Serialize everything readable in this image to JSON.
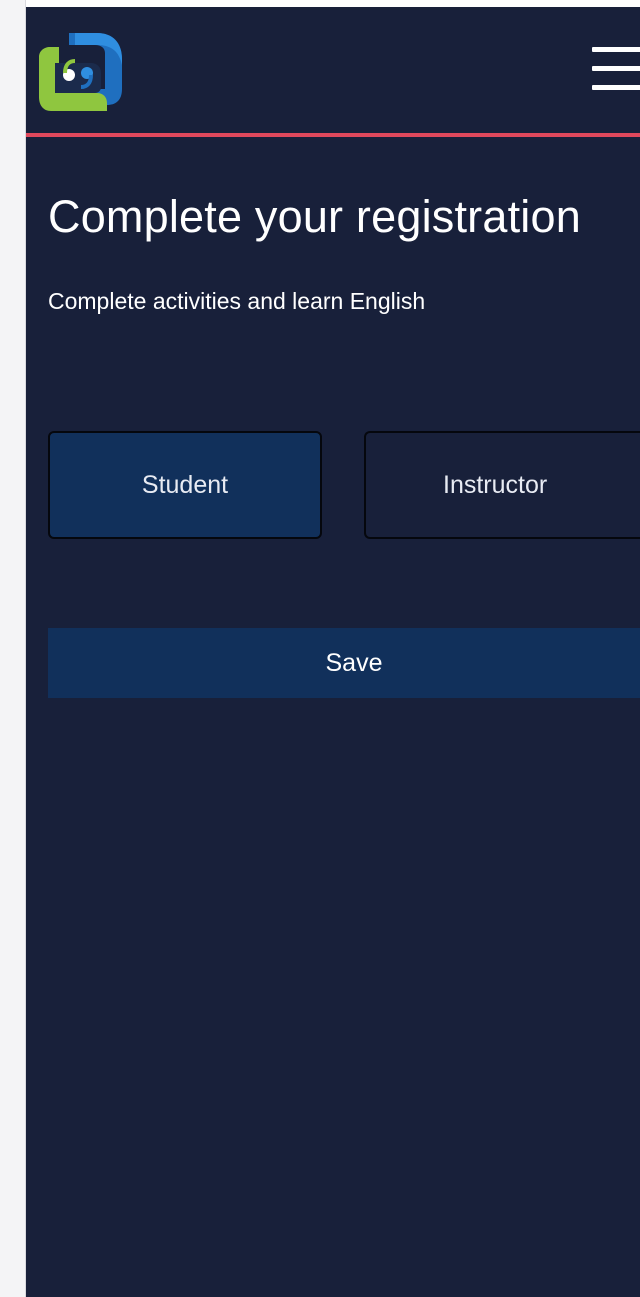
{
  "header": {
    "logo_icon": "chat-bubble-logo-icon",
    "menu_icon": "hamburger-menu-icon",
    "accent_color": "#e0485c"
  },
  "registration": {
    "title": "Complete your registration",
    "subtitle": "Complete activities and learn English",
    "roles": [
      {
        "label": "Student",
        "selected": true
      },
      {
        "label": "Instructor",
        "selected": false
      }
    ],
    "save_label": "Save"
  },
  "colors": {
    "background": "#18203a",
    "selected_role": "#11305b",
    "button": "#11305b",
    "logo_green": "#8fc63f",
    "logo_blue": "#1f6fbf"
  }
}
